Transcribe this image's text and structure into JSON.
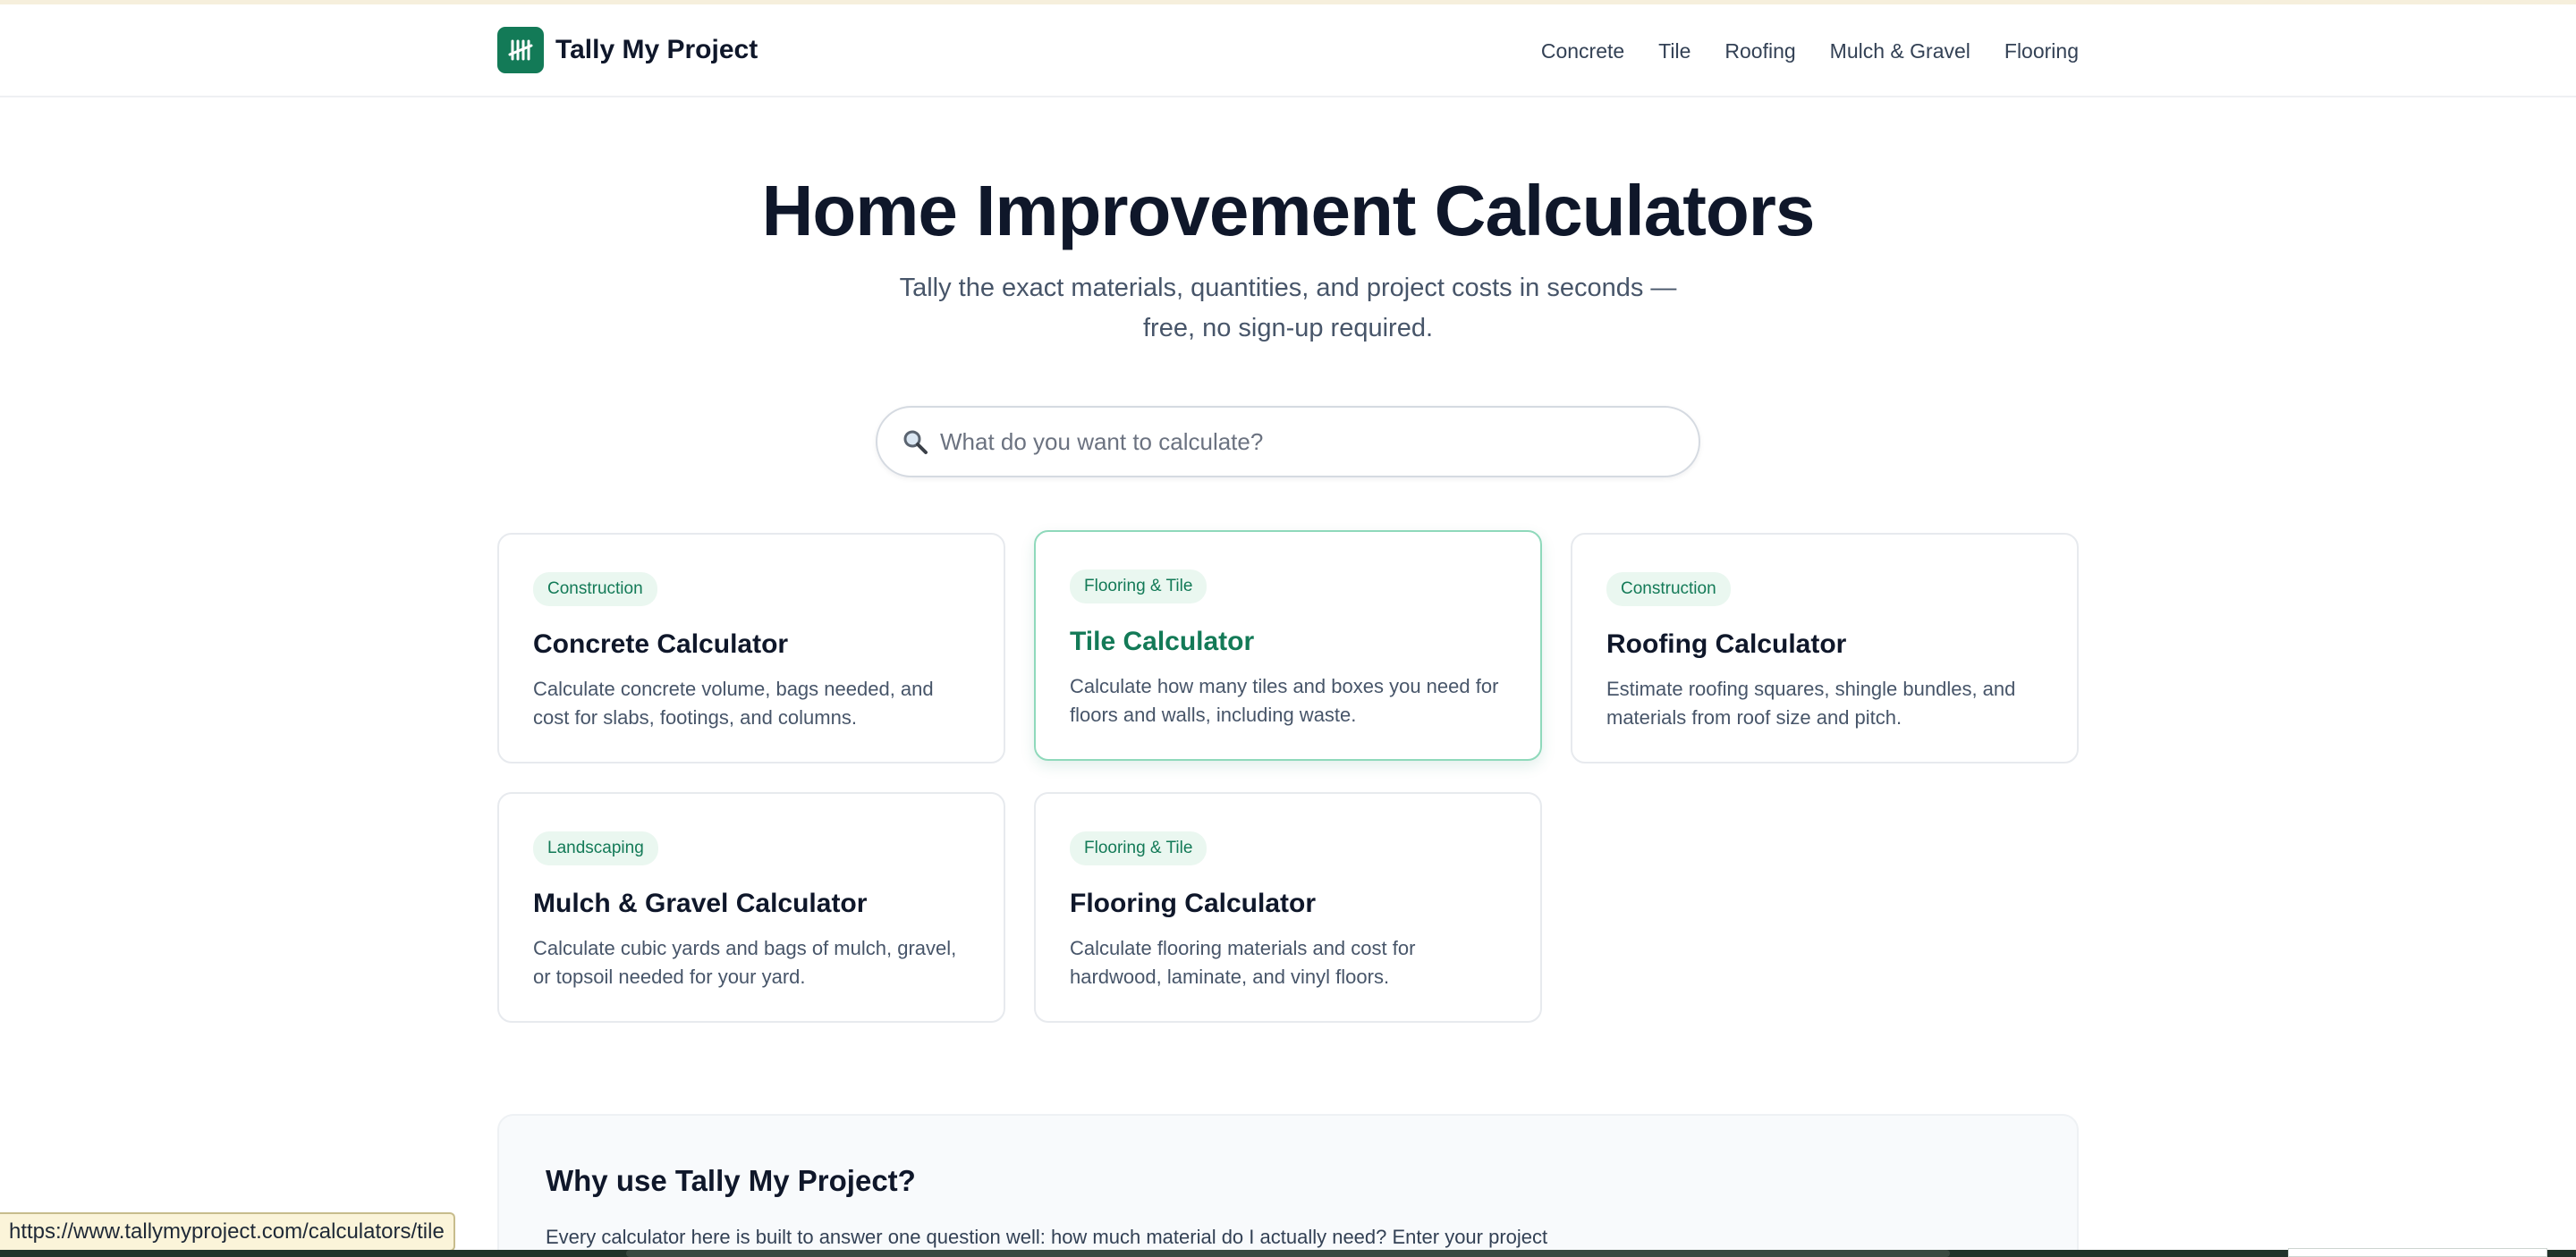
{
  "brand": {
    "name": "Tally My Project",
    "logo_icon": "tally-marks-icon",
    "logo_color": "#137a57"
  },
  "nav": [
    {
      "label": "Concrete"
    },
    {
      "label": "Tile"
    },
    {
      "label": "Roofing"
    },
    {
      "label": "Mulch & Gravel"
    },
    {
      "label": "Flooring"
    }
  ],
  "hero": {
    "title": "Home Improvement Calculators",
    "subtitle_line1": "Tally the exact materials, quantities, and project costs in seconds —",
    "subtitle_line2": "free, no sign-up required."
  },
  "search": {
    "placeholder": "What do you want to calculate?",
    "icon": "magnifier-icon",
    "value": ""
  },
  "cards": [
    {
      "category": "Construction",
      "title": "Concrete Calculator",
      "description": "Calculate concrete volume, bags needed, and cost for slabs, footings, and columns.",
      "hovered": false
    },
    {
      "category": "Flooring & Tile",
      "title": "Tile Calculator",
      "description": "Calculate how many tiles and boxes you need for floors and walls, including waste.",
      "hovered": true
    },
    {
      "category": "Construction",
      "title": "Roofing Calculator",
      "description": "Estimate roofing squares, shingle bundles, and materials from roof size and pitch.",
      "hovered": false
    },
    {
      "category": "Landscaping",
      "title": "Mulch & Gravel Calculator",
      "description": "Calculate cubic yards and bags of mulch, gravel, or topsoil needed for your yard.",
      "hovered": false
    },
    {
      "category": "Flooring & Tile",
      "title": "Flooring Calculator",
      "description": "Calculate flooring materials and cost for hardwood, laminate, and vinyl floors.",
      "hovered": false
    }
  ],
  "why": {
    "title": "Why use Tally My Project?",
    "text": "Every calculator here is built to answer one question well: how much material do I actually need? Enter your project"
  },
  "status_bar": {
    "url": "https://www.tallymyproject.com/calculators/tile"
  },
  "colors": {
    "accent": "#137a57",
    "badge_bg": "#eaf7f0",
    "text": "#0f172a",
    "muted": "#475569"
  }
}
